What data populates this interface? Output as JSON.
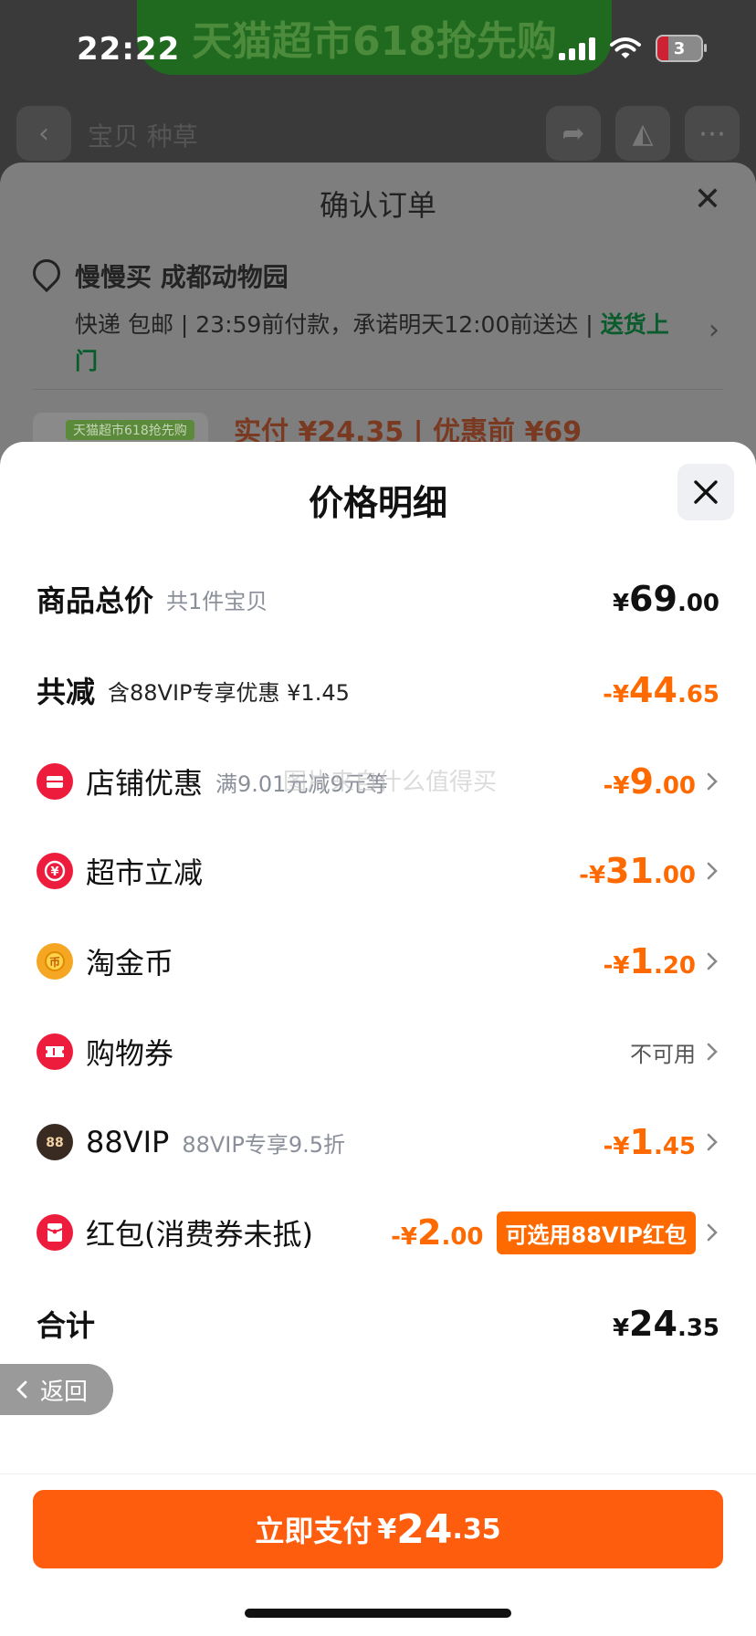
{
  "status_bar": {
    "time": "22:22",
    "battery": "3"
  },
  "background": {
    "banner": "天猫超市618抢先购",
    "tabs": "宝贝  种草",
    "order_sheet": {
      "title": "确认订单",
      "address_name": "慢慢买 成都动物园",
      "delivery_line": "快递 包邮 | 23:59前付款，承诺明天12:00前送达 | ",
      "delivery_tag": "送货上门",
      "thumb_tag": "天猫超市618抢先购",
      "peek_text": "实付 ¥24.35 | 优惠前 ¥69"
    }
  },
  "panel": {
    "title": "价格明细",
    "total_goods": {
      "label": "商品总价",
      "sub": "共1件宝贝",
      "currency": "¥",
      "int": "69",
      "dec": ".00"
    },
    "total_discount": {
      "label": "共减",
      "sub": "含88VIP专享优惠 ¥1.45",
      "currency": "-¥",
      "int": "44",
      "dec": ".65"
    },
    "items": [
      {
        "label": "店铺优惠",
        "sub": "满9.01元减9元等",
        "currency": "-¥",
        "int": "9",
        "dec": ".00",
        "icon": "shop-coupon-icon",
        "color": "#ee1c3c"
      },
      {
        "label": "超市立减",
        "sub": "",
        "currency": "-¥",
        "int": "31",
        "dec": ".00",
        "icon": "yen-discount-icon",
        "color": "#ee1c3c"
      },
      {
        "label": "淘金币",
        "sub": "",
        "currency": "-¥",
        "int": "1",
        "dec": ".20",
        "icon": "gold-coin-icon",
        "color": "#f5a623"
      },
      {
        "label": "购物券",
        "sub": "",
        "status": "不可用",
        "icon": "ticket-icon",
        "color": "#ee1c3c"
      },
      {
        "label": "88VIP",
        "sub": "88VIP专享9.5折",
        "currency": "-¥",
        "int": "1",
        "dec": ".45",
        "icon": "vip88-icon",
        "color": "#3a2b22"
      },
      {
        "label": "红包(消费券未抵)",
        "sub": "",
        "currency": "-¥",
        "int": "2",
        "dec": ".00",
        "tag": "可选用88VIP红包",
        "icon": "red-packet-icon",
        "color": "#ee1c3c"
      }
    ],
    "grand_total": {
      "label": "合计",
      "currency": "¥",
      "int": "24",
      "dec": ".35"
    },
    "watermark": "图片来自什么值得买"
  },
  "back_button": "返回",
  "pay_button": {
    "label": "立即支付",
    "currency": "¥",
    "int": "24",
    "dec": ".35"
  }
}
